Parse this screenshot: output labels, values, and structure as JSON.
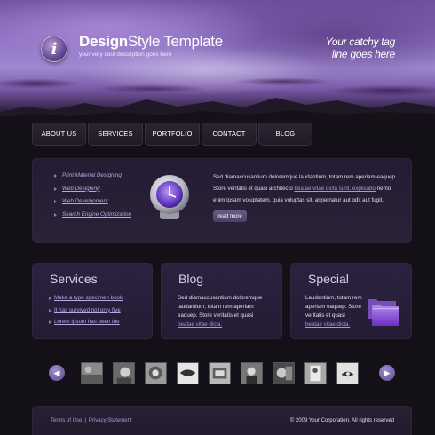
{
  "header": {
    "brand_bold": "Design",
    "brand_mid": "Style",
    "brand_light": " Template",
    "description": "your very cool description goes here",
    "tagline_line1": "Your catchy tag",
    "tagline_line2": "line goes here",
    "logo_letter": "i"
  },
  "nav": [
    "ABOUT US",
    "SERVICES",
    "PORTFOLIO",
    "CONTACT",
    "BLOG"
  ],
  "featured": {
    "links": [
      "Print Material Designing",
      "Web Designing",
      "Web Development",
      "Search Engine Optimization"
    ],
    "text_part1": "Sed diamaccusantium doloremque laudantium, totam rem aperiam eaquep. Store veritatis et quasi architecto ",
    "text_link": "beatae vitae dicta sunt, explicabo",
    "text_part2": " nemo enim ipsam voluptatem, quia voluptas sit, aspernatur aut odit aut fugit.",
    "read_more": "read more"
  },
  "services": {
    "title": "Services",
    "items": [
      "Make a type specimen book",
      "It has survived not only five",
      "Lorem Ipsum has been the"
    ]
  },
  "blog": {
    "title": "Blog",
    "text": "Sed diamaccusantium doloremque laudantium, totam rem aperiam eaquep. Store veritatis et quasi",
    "link": "beatae vitae dicta."
  },
  "special": {
    "title": "Special",
    "text": "Laudantium, totam rem aperiam eaquep. Store veritatis et quasi",
    "link": "beatae vitae dicta."
  },
  "footer": {
    "terms": "Terms of Use",
    "separator": "|",
    "privacy": "Privacy Statement",
    "copyright": "© 2009 Your Corporation. All rights reserved"
  },
  "colors": {
    "accent": "#b9a7e6",
    "background": "#141018",
    "panel": "#2b2240"
  },
  "icons": {
    "logo": "info-icon",
    "featured": "clock-icon",
    "special": "folders-icon",
    "prev": "arrow-left-icon",
    "next": "arrow-right-icon"
  }
}
